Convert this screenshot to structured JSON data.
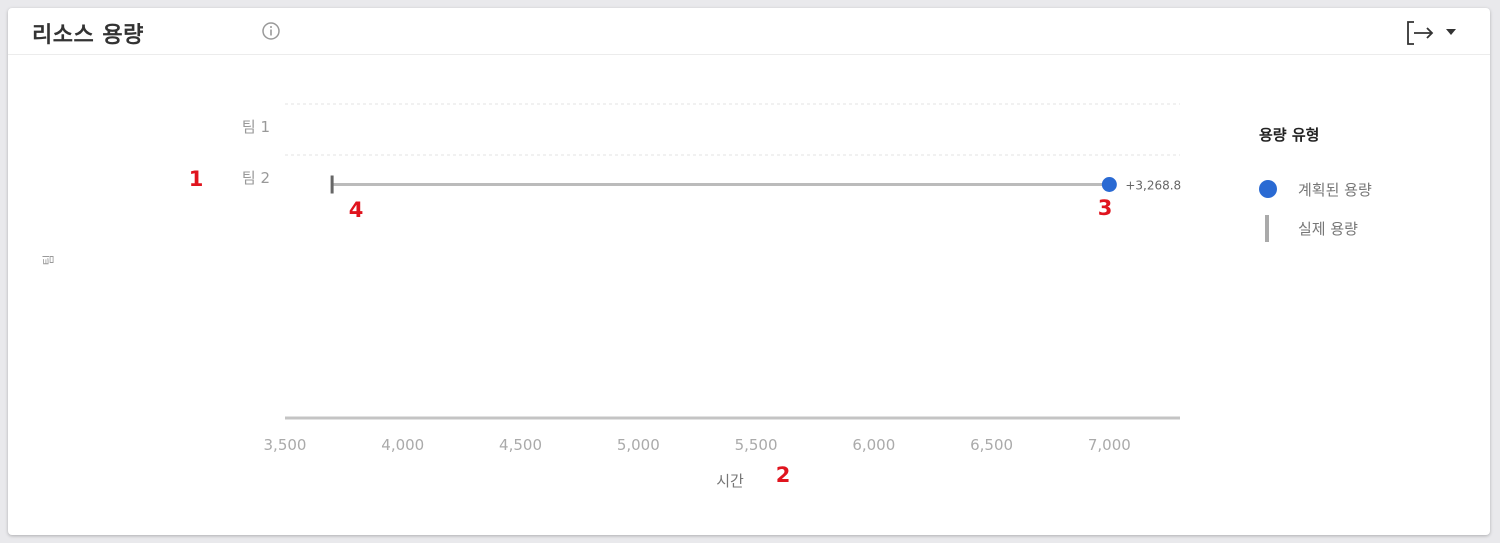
{
  "widget": {
    "title": "리소스 용량",
    "info_icon": "info-icon",
    "export_icon": "export-icon",
    "dropdown_icon": "caret-down-icon"
  },
  "annotations": [
    "1",
    "2",
    "3",
    "4"
  ],
  "chart_data": {
    "type": "scatter",
    "title": "",
    "xlabel": "시간",
    "ylabel": "팀",
    "xlim": [
      3500,
      7300
    ],
    "x_ticks": [
      "3,500",
      "4,000",
      "4,500",
      "5,000",
      "5,500",
      "6,000",
      "6,500",
      "7,000"
    ],
    "categories": [
      "팀 1",
      "팀 2"
    ],
    "legend_title": "용량 유형",
    "legend_position": "right",
    "series": [
      {
        "name": "계획된 용량",
        "color": "#2a6ad3",
        "points": [
          {
            "category": "팀 2",
            "x": 7000,
            "label": "+3,268.8"
          }
        ]
      },
      {
        "name": "실제 용량",
        "color": "#666666",
        "points": [
          {
            "category": "팀 2",
            "x": 3700
          }
        ]
      }
    ],
    "range_line": {
      "category": "팀 2",
      "from": 3700,
      "to": 7000,
      "color": "#bbbbbb"
    }
  }
}
